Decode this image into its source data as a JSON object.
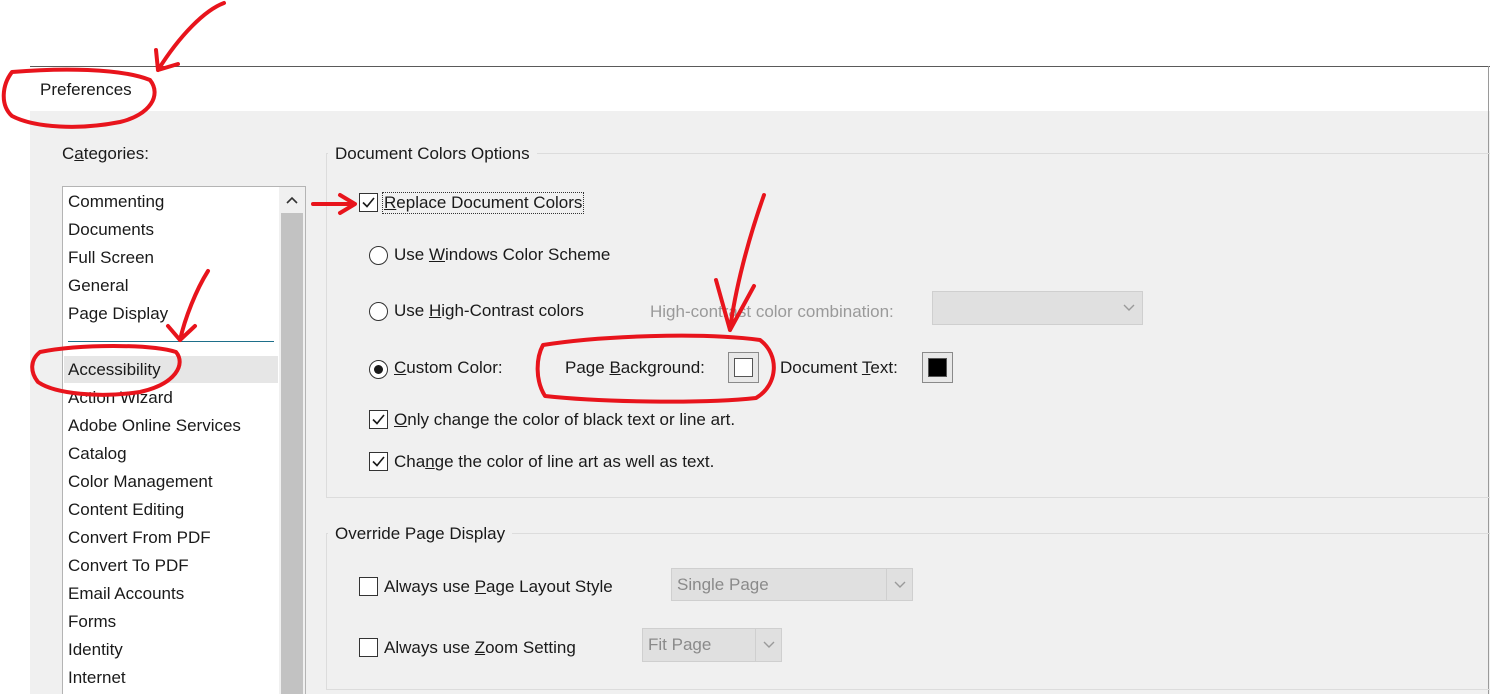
{
  "window": {
    "title": "Preferences"
  },
  "categories": {
    "label_prefix": "C",
    "label_underlined": "a",
    "label_suffix": "tegories:",
    "pinned": [
      "Commenting",
      "Documents",
      "Full Screen",
      "General",
      "Page Display"
    ],
    "selected": "Accessibility",
    "items": [
      "Action Wizard",
      "Adobe Online Services",
      "Catalog",
      "Color Management",
      "Content Editing",
      "Convert From PDF",
      "Convert To PDF",
      "Email Accounts",
      "Forms",
      "Identity",
      "Internet"
    ]
  },
  "document_colors": {
    "title": "Document Colors Options",
    "replace": {
      "label_underlined": "R",
      "label_rest": "eplace Document Colors",
      "checked": true
    },
    "windows_scheme": {
      "prefix": "Use ",
      "underlined": "W",
      "suffix": "indows Color Scheme",
      "selected": false
    },
    "high_contrast": {
      "prefix": "Use ",
      "underlined": "H",
      "suffix": "igh-Contrast colors",
      "selected": false
    },
    "combination_label": "High-contrast color combination:",
    "combination_value": "",
    "custom": {
      "underlined": "C",
      "suffix": "ustom Color:",
      "selected": true
    },
    "page_background": {
      "prefix": "Page ",
      "underlined": "B",
      "suffix": "ackground:",
      "color": "#ffffff"
    },
    "document_text": {
      "prefix": "Document ",
      "underlined": "T",
      "suffix": "ext:",
      "color": "#000000"
    },
    "only_black": {
      "underlined": "O",
      "suffix": "nly change the color of black text or line art.",
      "checked": true
    },
    "line_art": {
      "prefix": "Cha",
      "underlined": "n",
      "suffix": "ge the color of line art as well as text.",
      "checked": true
    }
  },
  "override": {
    "title": "Override Page Display",
    "layout": {
      "prefix": "Always use ",
      "underlined": "P",
      "suffix": "age Layout Style",
      "checked": false,
      "value": "Single Page"
    },
    "zoom": {
      "prefix": "Always use ",
      "underlined": "Z",
      "suffix": "oom Setting",
      "checked": false,
      "value": "Fit Page"
    }
  },
  "colors": {
    "annotation": "#e8141c",
    "background": "#f0f0f0",
    "selection": "#e6e6e6",
    "separator": "#1e6f8a"
  },
  "icons": {
    "check": "checkmark-icon",
    "dropdown": "chevron-down-icon",
    "scroll": "chevron-up-icon"
  }
}
